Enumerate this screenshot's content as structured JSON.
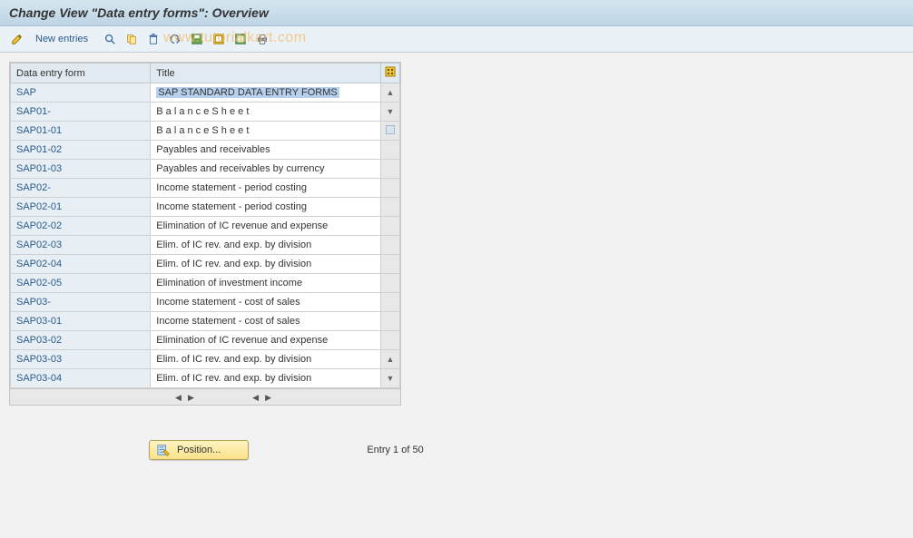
{
  "title": "Change View \"Data entry forms\": Overview",
  "toolbar": {
    "new_entries": "New entries"
  },
  "watermark": "www.tutorialkart.com",
  "table": {
    "headers": {
      "code": "Data entry form",
      "title": "Title"
    },
    "rows": [
      {
        "code": "SAP",
        "title": "SAP STANDARD DATA ENTRY FORMS",
        "selected": true
      },
      {
        "code": "SAP01-",
        "title": "B a l a n c e   S h e e t",
        "spaced": true
      },
      {
        "code": "SAP01-01",
        "title": "B a l a n c e   S h e e t",
        "spaced": true
      },
      {
        "code": "SAP01-02",
        "title": "Payables and receivables"
      },
      {
        "code": "SAP01-03",
        "title": "Payables and receivables by currency"
      },
      {
        "code": "SAP02-",
        "title": "Income statement - period costing"
      },
      {
        "code": "SAP02-01",
        "title": "Income statement - period costing"
      },
      {
        "code": "SAP02-02",
        "title": "Elimination of IC revenue and expense"
      },
      {
        "code": "SAP02-03",
        "title": "Elim. of IC rev. and exp. by division"
      },
      {
        "code": "SAP02-04",
        "title": "Elim. of IC rev. and exp. by division"
      },
      {
        "code": "SAP02-05",
        "title": "Elimination of investment income"
      },
      {
        "code": "SAP03-",
        "title": "Income statement - cost of sales"
      },
      {
        "code": "SAP03-01",
        "title": "Income statement - cost of sales"
      },
      {
        "code": "SAP03-02",
        "title": "Elimination of IC revenue and expense"
      },
      {
        "code": "SAP03-03",
        "title": "Elim. of IC rev. and exp. by division"
      },
      {
        "code": "SAP03-04",
        "title": "Elim. of IC rev. and exp. by division"
      }
    ]
  },
  "footer": {
    "position_label": "Position...",
    "entry_text": "Entry 1 of 50"
  }
}
